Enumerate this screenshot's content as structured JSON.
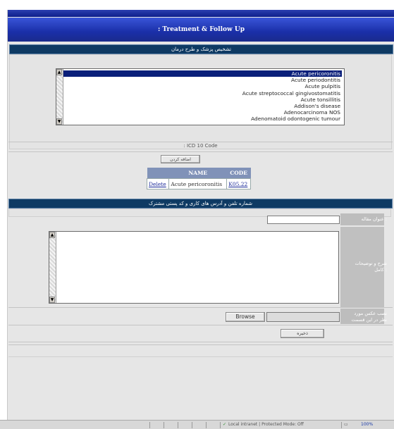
{
  "header": {
    "title": ": Treatment & Follow Up"
  },
  "diagnosis_section": {
    "title": "تشخیص پزشک و طرح درمان"
  },
  "diagnosis_list": {
    "items": [
      "Acute pericoronitis",
      "Acute periodontitis",
      "Acute pulpitis",
      "Acute streptococcal gingivostomatitis",
      "Acute tonsillitis",
      "Addison's disease",
      "Adenocarcinoma NOS",
      "Adenomatoid odontogenic tumour"
    ],
    "selected_index": 0
  },
  "icd": {
    "label": ": ICD 10 Code",
    "add_button": "اضافه کردن",
    "table": {
      "headers": [
        "NAME",
        "CODE"
      ],
      "rows": [
        {
          "action": "Delete",
          "name": "Acute pericoronitis",
          "code": "K05.22"
        }
      ]
    }
  },
  "plan_section": {
    "title": "شماره تلفن و آدرس های کاری و کد پستی مشترک"
  },
  "form": {
    "subject_label": "عنوان مقاله :",
    "subject_value": "",
    "description_label": "شرح و توضیحات کامل :",
    "description_value": "",
    "file_label": "نصب عکس مورد نظر در این قسمت",
    "browse_button": "Browse",
    "file_value": "",
    "save_button": "ذخیره"
  },
  "statusbar": {
    "zone_text": "Local intranet | Protected Mode: Off",
    "zoom": "100%"
  }
}
